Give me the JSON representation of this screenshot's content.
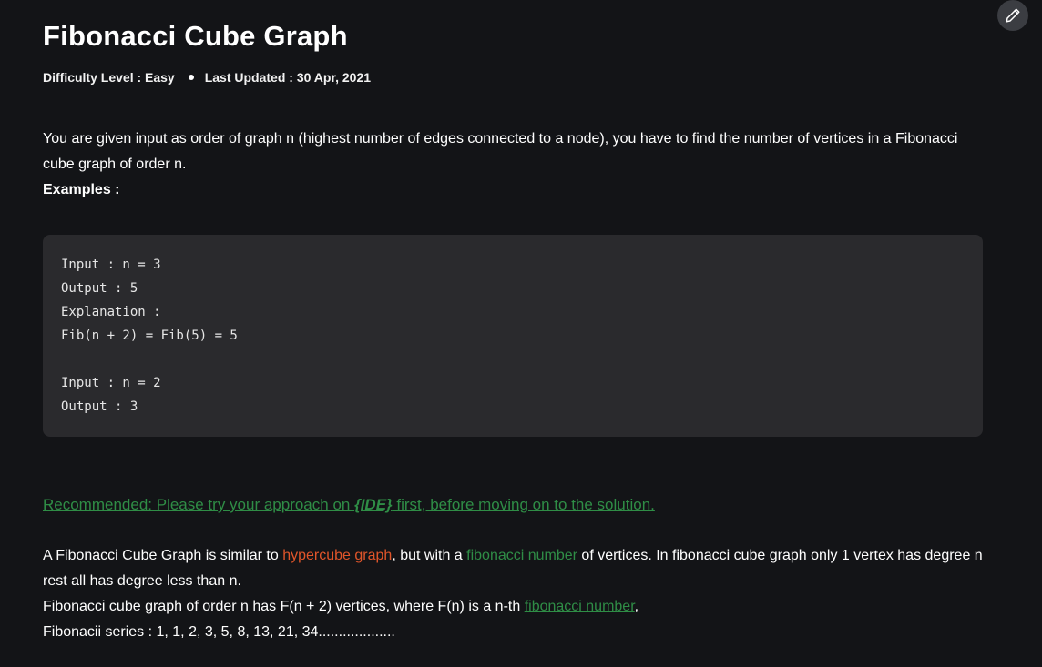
{
  "article": {
    "title": "Fibonacci Cube Graph",
    "difficulty": "Difficulty Level : Easy",
    "last_updated": "Last Updated : 30 Apr, 2021"
  },
  "intro": {
    "line1": "You are given input as order of graph n (highest number of edges connected to a node), you have to find the number of vertices in a Fibonacci cube graph of order n.",
    "examples_heading": "Examples :"
  },
  "code_block": {
    "lines": [
      "Input : n = 3",
      "Output : 5",
      "Explanation :",
      "Fib(n + 2) = Fib(5) = 5",
      "",
      "Input : n = 2",
      "Output : 3"
    ]
  },
  "recommended": {
    "prefix": "Recommended: Please try your approach on ",
    "ide": "{IDE}",
    "suffix": " first, before moving on to the solution."
  },
  "body": {
    "p1_part1": "A Fibonacci Cube Graph is similar to ",
    "p1_link1": "hypercube graph",
    "p1_part2": ", but with a ",
    "p1_link2": "fibonacci number",
    "p1_part3": " of vertices. In fibonacci cube graph only 1 vertex has degree n rest all has degree less than n.",
    "p2_part1": "Fibonacci cube graph of order n has F(n + 2) vertices, where F(n) is a n-th ",
    "p2_link": "fibonacci number",
    "p2_part2": ",",
    "p3": "Fibonacii series : 1, 1, 2, 3, 5, 8, 13, 21, 34..................."
  },
  "toolbar": {
    "edit_icon": "pencil-icon"
  },
  "colors": {
    "background": "#131417",
    "code_background": "#2a2a2d",
    "link_green": "#2f8d46",
    "link_red": "#e0552a"
  }
}
